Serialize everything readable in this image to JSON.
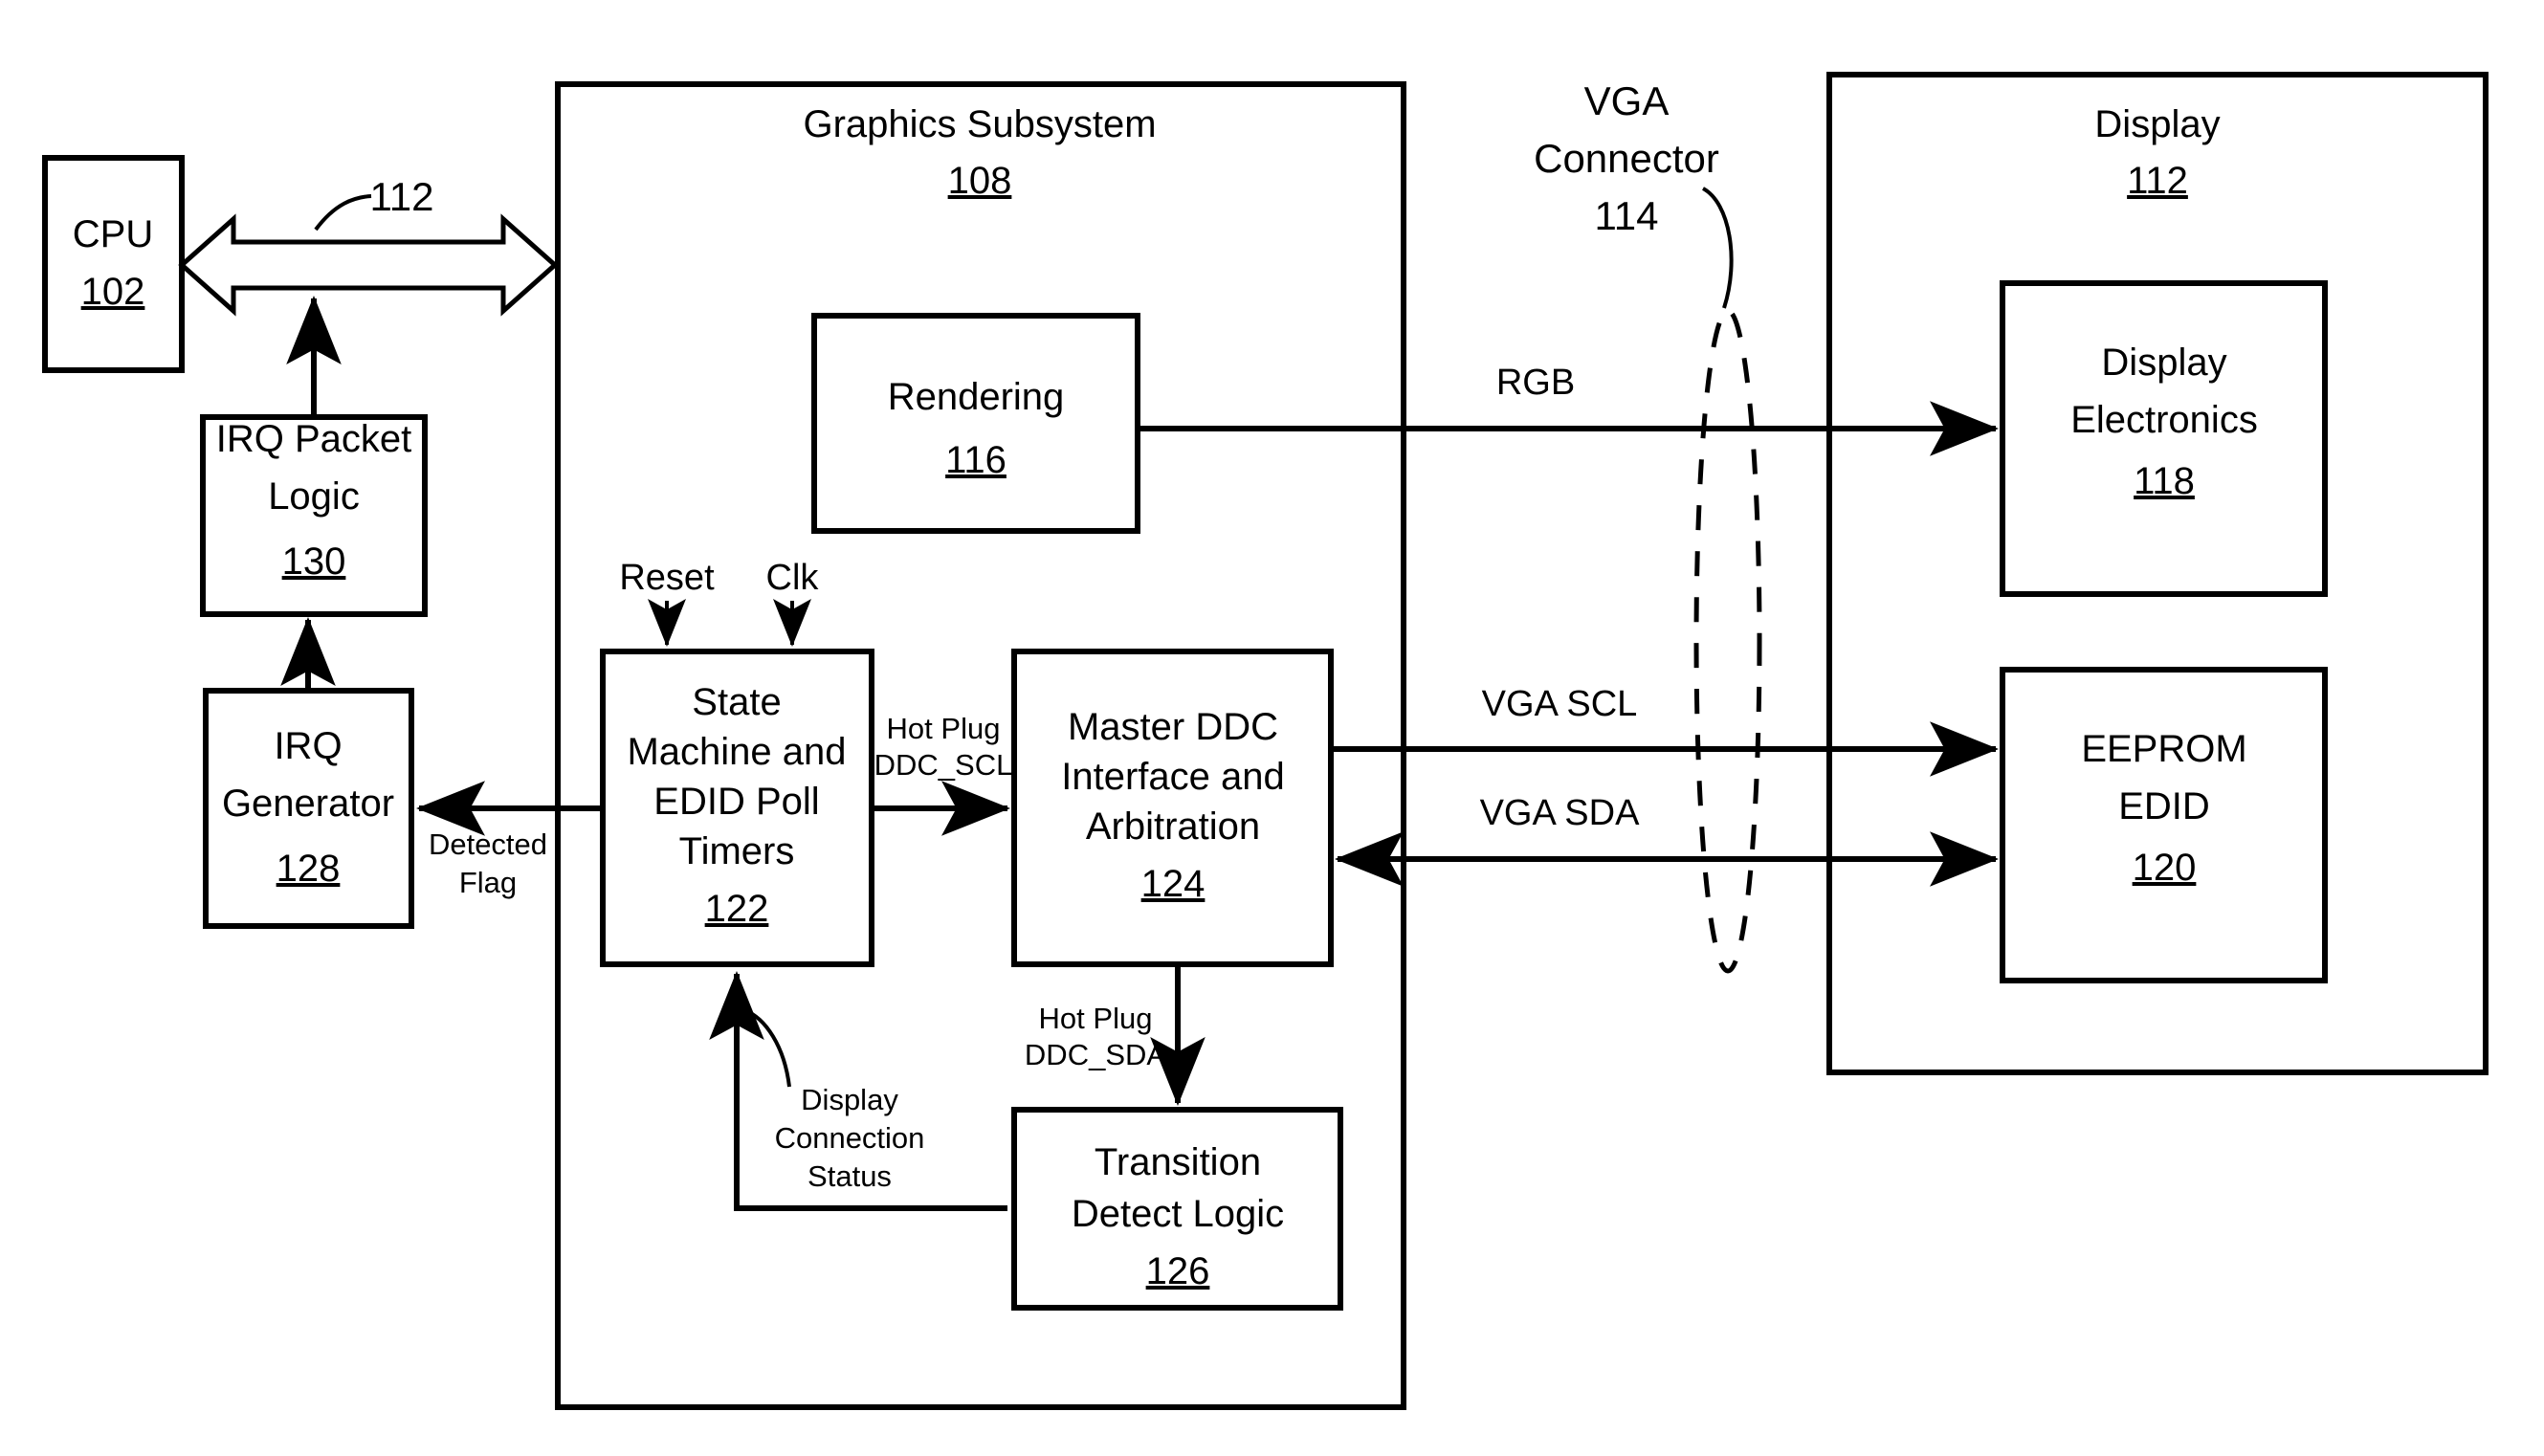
{
  "figure": {
    "type": "patent-block-diagram",
    "background_color": "#ffffff",
    "line_color": "#000000"
  },
  "blocks": {
    "cpu": {
      "label": "CPU",
      "ref": "102"
    },
    "irq_packet_logic": {
      "line1": "IRQ Packet",
      "line2": "Logic",
      "ref": "130"
    },
    "irq_generator": {
      "line1": "IRQ",
      "line2": "Generator",
      "ref": "128"
    },
    "graphics_subsystem": {
      "label": "Graphics Subsystem",
      "ref": "108"
    },
    "rendering": {
      "label": "Rendering",
      "ref": "116"
    },
    "state_machine": {
      "line1": "State",
      "line2": "Machine and",
      "line3": "EDID Poll",
      "line4": "Timers",
      "ref": "122"
    },
    "master_ddc": {
      "line1": "Master DDC",
      "line2": "Interface and",
      "line3": "Arbitration",
      "ref": "124"
    },
    "transition_detect": {
      "line1": "Transition",
      "line2": "Detect Logic",
      "ref": "126"
    },
    "display": {
      "label": "Display",
      "ref": "112"
    },
    "display_electronics": {
      "line1": "Display",
      "line2": "Electronics",
      "ref": "118"
    },
    "eeprom_edid": {
      "line1": "EEPROM",
      "line2": "EDID",
      "ref": "120"
    }
  },
  "callouts": {
    "bus_112": "112",
    "vga_connector": {
      "line1": "VGA",
      "line2": "Connector",
      "ref": "114"
    }
  },
  "signals": {
    "reset": "Reset",
    "clk": "Clk",
    "detected_flag": {
      "line1": "Detected",
      "line2": "Flag"
    },
    "hot_plug_scl": {
      "line1": "Hot Plug",
      "line2": "DDC_SCL"
    },
    "hot_plug_sda": {
      "line1": "Hot Plug",
      "line2": "DDC_SDA"
    },
    "display_connection_status": {
      "line1": "Display",
      "line2": "Connection",
      "line3": "Status"
    },
    "rgb": "RGB",
    "vga_scl": "VGA SCL",
    "vga_sda": "VGA SDA"
  }
}
